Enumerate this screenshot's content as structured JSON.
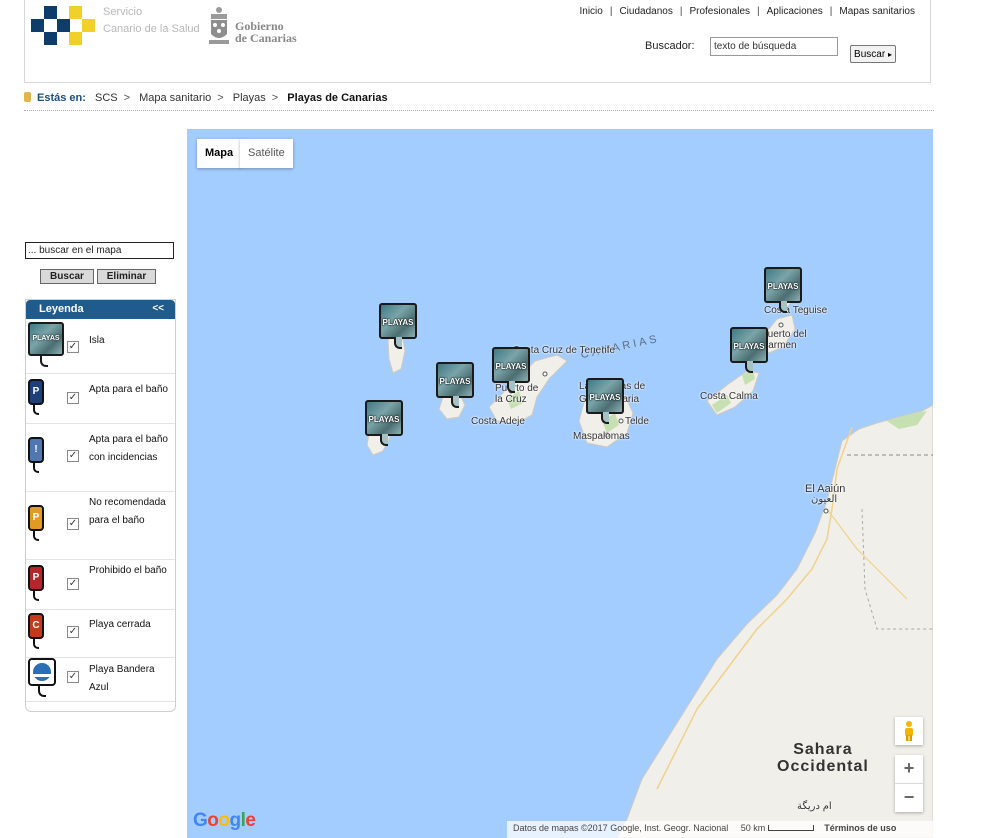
{
  "header": {
    "brand_line1": "Servicio",
    "brand_line2": "Canario de la Salud",
    "gov_line1": "Gobierno",
    "gov_line2": "de Canarias",
    "nav": [
      "Inicio",
      "Ciudadanos",
      "Profesionales",
      "Aplicaciones",
      "Mapas sanitarios"
    ],
    "search_label": "Buscador:",
    "search_value": "texto de búsqueda",
    "search_button": "Buscar",
    "brand_colors": {
      "blue": "#0f3d6b",
      "yellow": "#f2d02a"
    }
  },
  "breadcrumb": {
    "label": "Estás en:",
    "items": [
      "SCS",
      "Mapa sanitario",
      "Playas"
    ],
    "current": "Playas de Canarias"
  },
  "sidebar": {
    "map_search_value": "... buscar en el mapa",
    "search_button": "Buscar",
    "clear_button": "Eliminar",
    "legend": {
      "title": "Leyenda",
      "collapse": "<<",
      "items": [
        {
          "label": "Isla",
          "icon": "island-marker-icon",
          "color": "#5b8a90",
          "checked": true
        },
        {
          "label": "Apta para el baño",
          "icon": "suitable-beach-icon",
          "color": "#1f3f78",
          "checked": true
        },
        {
          "label": "Apta para el baño con incidencias",
          "icon": "beach-incidents-icon",
          "color": "#5077b0",
          "checked": true
        },
        {
          "label": "No recomendada para el baño",
          "icon": "not-recommended-beach-icon",
          "color": "#e39a22",
          "checked": true
        },
        {
          "label": "Prohibido el baño",
          "icon": "prohibited-beach-icon",
          "color": "#b3262c",
          "checked": true
        },
        {
          "label": "Playa cerrada",
          "icon": "closed-beach-icon",
          "color": "#c53a1d",
          "checked": true
        },
        {
          "label": "Playa Bandera Azul",
          "icon": "blue-flag-icon",
          "color": "#2a6fb5",
          "checked": true
        }
      ]
    }
  },
  "map": {
    "type_buttons": [
      "Mapa",
      "Satélite"
    ],
    "selected_type": "Mapa",
    "marker_label": "PLAYAS",
    "places": [
      "Santa Cruz de Tenerife",
      "Puerto de la Cruz",
      "Costa Adeje",
      "Las Palmas de Gran Canaria",
      "Telde",
      "Maspalomas",
      "Costa Teguise",
      "Puerto del Carmen",
      "Costa Calma",
      "El Aaiún",
      "العيون",
      "ام دريگة"
    ],
    "region_label": "CANARIAS",
    "sahara_label": [
      "Sahara",
      "Occidental"
    ],
    "attribution": "Datos de mapas ©2017 Google, Inst. Geogr. Nacional",
    "scale": "50 km",
    "terms": "Términos de uso",
    "logo": "Google",
    "zoom_in": "+",
    "zoom_out": "−",
    "colors": {
      "sea": "#a3ccff",
      "land": "#f1efe9"
    }
  }
}
